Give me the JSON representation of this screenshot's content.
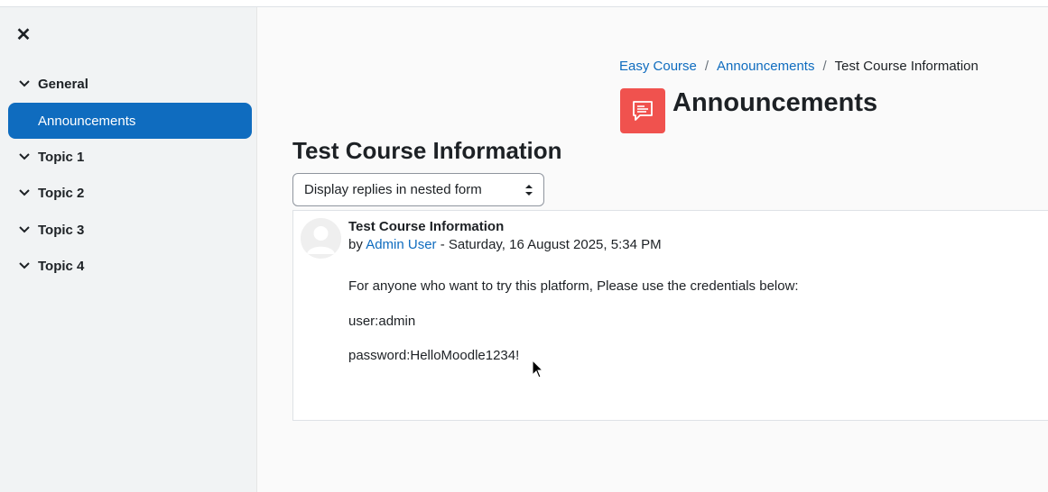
{
  "drawer": {
    "close_glyph": "✕",
    "sections": [
      {
        "label": "General"
      },
      {
        "label": "Topic 1"
      },
      {
        "label": "Topic 2"
      },
      {
        "label": "Topic 3"
      },
      {
        "label": "Topic 4"
      }
    ],
    "active_item": "Announcements"
  },
  "breadcrumb": {
    "items": [
      "Easy Course",
      "Announcements"
    ],
    "separator": "/",
    "current": "Test Course Information"
  },
  "activity": {
    "title": "Announcements",
    "icon": "forum-icon",
    "icon_color": "#f0524e"
  },
  "discussion": {
    "title": "Test Course Information",
    "display_mode": "Display replies in nested form"
  },
  "post": {
    "subject": "Test Course Information",
    "by_prefix": "by",
    "author": "Admin User",
    "date": " - Saturday, 16 August 2025, 5:34 PM",
    "body": [
      "For anyone who want to try this platform, Please use the credentials below:",
      "user:admin",
      "password:HelloMoodle1234!"
    ]
  },
  "colors": {
    "accent": "#0f6cbf",
    "drawer_bg": "#f1f3f4",
    "page_bg": "#fafafa"
  }
}
